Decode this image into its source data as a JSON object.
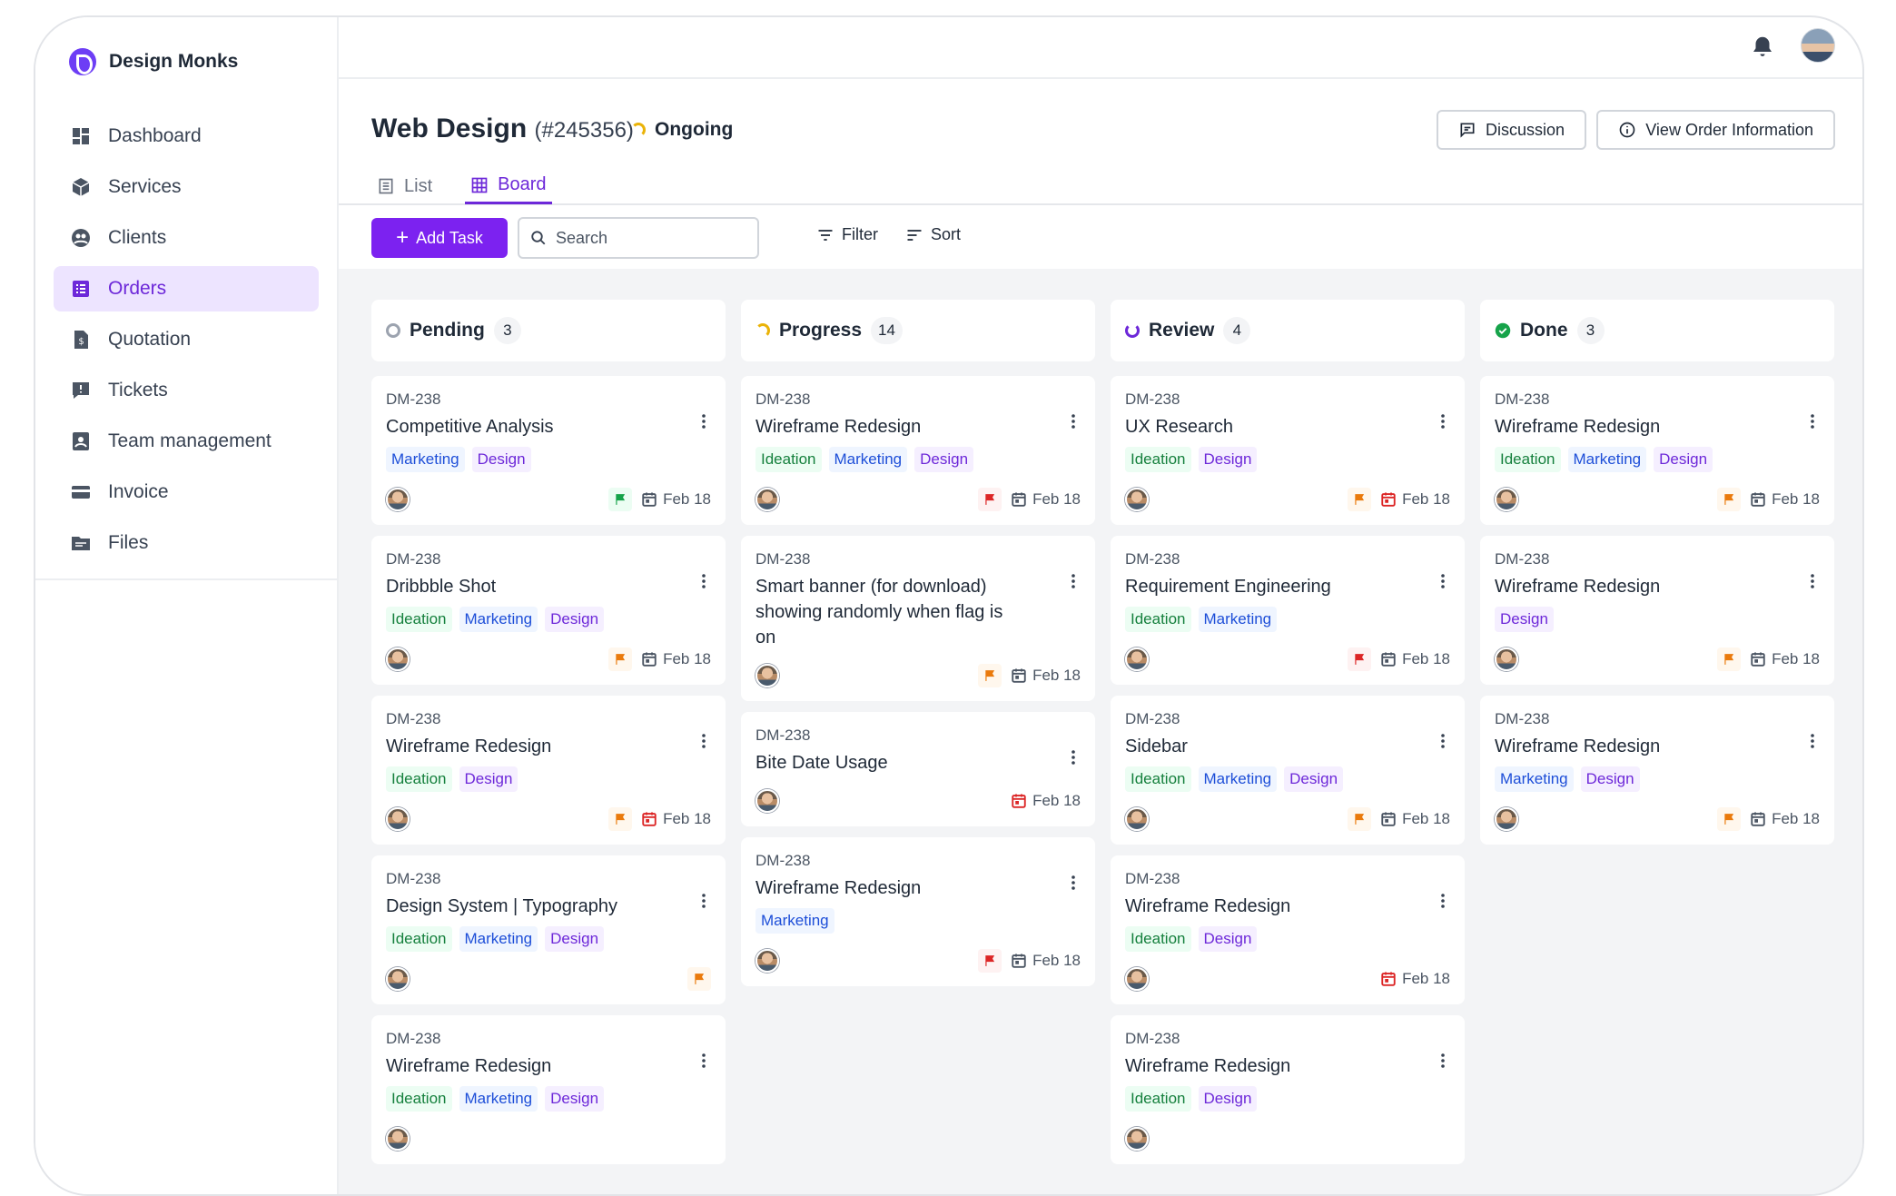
{
  "brand": {
    "name": "Design Monks"
  },
  "nav": {
    "items": [
      {
        "label": "Dashboard",
        "icon": "dashboard-icon"
      },
      {
        "label": "Services",
        "icon": "box-icon"
      },
      {
        "label": "Clients",
        "icon": "clients-icon"
      },
      {
        "label": "Orders",
        "icon": "orders-icon"
      },
      {
        "label": "Quotation",
        "icon": "quotation-icon"
      },
      {
        "label": "Tickets",
        "icon": "ticket-icon"
      },
      {
        "label": "Team management",
        "icon": "team-icon"
      },
      {
        "label": "Invoice",
        "icon": "invoice-icon"
      },
      {
        "label": "Files",
        "icon": "folder-icon"
      }
    ],
    "active": "Orders"
  },
  "header": {
    "title": "Web Design",
    "code": "(#245356)",
    "status": "Ongoing",
    "discussion_label": "Discussion",
    "view_order_label": "View Order Information",
    "tabs": [
      {
        "label": "List"
      },
      {
        "label": "Board"
      }
    ],
    "active_tab": "Board"
  },
  "toolbar": {
    "add_task_label": "Add Task",
    "search_placeholder": "Search",
    "filter_label": "Filter",
    "sort_label": "Sort"
  },
  "colors": {
    "accent": "#7c22f0",
    "pending": "#9ca3af",
    "progress": "#eab308",
    "review": "#6d28d9",
    "done": "#16a34a"
  },
  "columns": [
    {
      "title": "Pending",
      "count": "3",
      "status_icon": "pending-ring-icon",
      "cards": [
        {
          "id": "DM-238",
          "title": "Competitive Analysis",
          "tags": [
            "Marketing",
            "Design"
          ],
          "flag": "green",
          "date": "Feb 18",
          "date_icon": "gray"
        },
        {
          "id": "DM-238",
          "title": "Dribbble Shot",
          "tags": [
            "Ideation",
            "Marketing",
            "Design"
          ],
          "flag": "orange",
          "date": "Feb 18",
          "date_icon": "gray"
        },
        {
          "id": "DM-238",
          "title": "Wireframe Redesign",
          "tags": [
            "Ideation",
            "Design"
          ],
          "flag": "orange",
          "date": "Feb 18",
          "date_icon": "red"
        },
        {
          "id": "DM-238",
          "title": "Design System | Typography",
          "tags": [
            "Ideation",
            "Marketing",
            "Design"
          ],
          "flag": "orange",
          "date": "",
          "date_icon": ""
        },
        {
          "id": "DM-238",
          "title": "Wireframe Redesign",
          "tags": [
            "Ideation",
            "Marketing",
            "Design"
          ],
          "flag": "",
          "date": "",
          "date_icon": ""
        }
      ]
    },
    {
      "title": "Progress",
      "count": "14",
      "status_icon": "progress-ring-icon",
      "cards": [
        {
          "id": "DM-238",
          "title": "Wireframe Redesign",
          "tags": [
            "Ideation",
            "Marketing",
            "Design"
          ],
          "flag": "red",
          "date": "Feb 18",
          "date_icon": "gray"
        },
        {
          "id": "DM-238",
          "title": "Smart banner (for download) showing randomly when flag is on",
          "tags": [],
          "flag": "orange",
          "date": "Feb 18",
          "date_icon": "gray"
        },
        {
          "id": "DM-238",
          "title": "Bite Date Usage",
          "tags": [],
          "flag": "",
          "date": "Feb 18",
          "date_icon": "red"
        },
        {
          "id": "DM-238",
          "title": "Wireframe Redesign",
          "tags": [
            "Marketing"
          ],
          "flag": "red",
          "date": "Feb 18",
          "date_icon": "gray"
        }
      ]
    },
    {
      "title": "Review",
      "count": "4",
      "status_icon": "review-ring-icon",
      "cards": [
        {
          "id": "DM-238",
          "title": "UX Research",
          "tags": [
            "Ideation",
            "Design"
          ],
          "flag": "orange",
          "date": "Feb 18",
          "date_icon": "red"
        },
        {
          "id": "DM-238",
          "title": "Requirement Engineering",
          "tags": [
            "Ideation",
            "Marketing"
          ],
          "flag": "red",
          "date": "Feb 18",
          "date_icon": "gray"
        },
        {
          "id": "DM-238",
          "title": "Sidebar",
          "tags": [
            "Ideation",
            "Marketing",
            "Design"
          ],
          "flag": "orange",
          "date": "Feb 18",
          "date_icon": "gray"
        },
        {
          "id": "DM-238",
          "title": "Wireframe Redesign",
          "tags": [
            "Ideation",
            "Design"
          ],
          "flag": "",
          "date": "Feb 18",
          "date_icon": "red"
        },
        {
          "id": "DM-238",
          "title": "Wireframe Redesign",
          "tags": [
            "Ideation",
            "Design"
          ],
          "flag": "",
          "date": "",
          "date_icon": ""
        }
      ]
    },
    {
      "title": "Done",
      "count": "3",
      "status_icon": "done-check-icon",
      "cards": [
        {
          "id": "DM-238",
          "title": "Wireframe Redesign",
          "tags": [
            "Ideation",
            "Marketing",
            "Design"
          ],
          "flag": "orange",
          "date": "Feb 18",
          "date_icon": "gray"
        },
        {
          "id": "DM-238",
          "title": "Wireframe Redesign",
          "tags": [
            "Design"
          ],
          "flag": "orange",
          "date": "Feb 18",
          "date_icon": "gray"
        },
        {
          "id": "DM-238",
          "title": "Wireframe Redesign",
          "tags": [
            "Marketing",
            "Design"
          ],
          "flag": "orange",
          "date": "Feb 18",
          "date_icon": "gray"
        }
      ]
    }
  ]
}
